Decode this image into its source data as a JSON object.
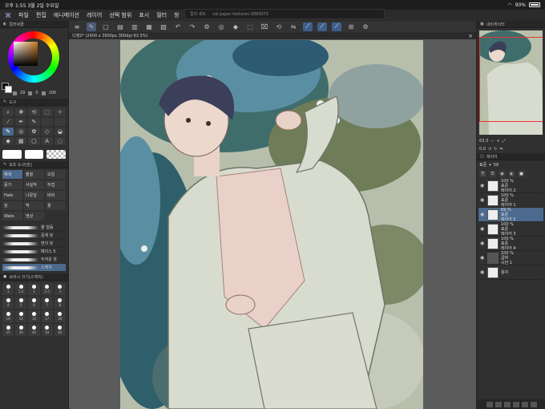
{
  "status": {
    "time": "오후 1:55",
    "date": "3월 2일 수요일",
    "battery": "90%"
  },
  "menu": {
    "items": [
      "파일",
      "편집",
      "애니메이션",
      "레이어",
      "선택 범위",
      "표시",
      "필터",
      "창"
    ]
  },
  "window_tabs": [
    "컬러 세트",
    "val paper textures-1893075"
  ],
  "document_tab": "디영2* (2400 x 3600px 300dpi 63.3%)",
  "left_panel": {
    "color_header": "컬러써클",
    "color_values": [
      "29",
      "0",
      "100"
    ],
    "tool_header": "도구",
    "subtool_header": "보조 도구[붓]",
    "subtools": [
      "채색",
      "물칠",
      "오일",
      "뭉기",
      "사실적",
      "두껍",
      "Halo",
      "나뭇잎",
      "비비",
      "붓",
      "먹",
      "꽃",
      "Wato",
      "명상"
    ],
    "brushes": [
      "물 얼음",
      "뭉게 붓",
      "면의 붓",
      "페이스 5",
      "두꺼운 붓",
      "스케치"
    ],
    "size_header": "브러시 크기(스케치)",
    "sizes": [
      "1",
      "1.5",
      "2",
      "2.5",
      "3",
      "4",
      "5",
      "6",
      "7",
      "8",
      "10",
      "12",
      "15",
      "17",
      "20",
      "25",
      "30",
      "40",
      "50",
      "60"
    ]
  },
  "navigator": {
    "header": "내비게이터",
    "zoom": "63.3",
    "rotation": "0.0"
  },
  "layers": {
    "header": "레이어",
    "blend": "표준",
    "opacity": "59",
    "rows": [
      {
        "opacity": "100 %",
        "mode": "표준",
        "name": "레이어 2"
      },
      {
        "opacity": "100 %",
        "mode": "표준",
        "name": "레이어 1"
      },
      {
        "opacity": "69 %",
        "mode": "표준",
        "name": "레이어 5"
      },
      {
        "opacity": "100 %",
        "mode": "표준",
        "name": "레이어 3"
      },
      {
        "opacity": "100 %",
        "mode": "표준",
        "name": "레이어 4"
      },
      {
        "opacity": "100 %",
        "mode": "곱하",
        "name": "시안 1"
      },
      {
        "opacity": "",
        "mode": "",
        "name": "용지"
      }
    ]
  },
  "colors": {
    "accent": "#4b6a8e",
    "bg": "#2b2b2b",
    "panel": "#303030"
  }
}
